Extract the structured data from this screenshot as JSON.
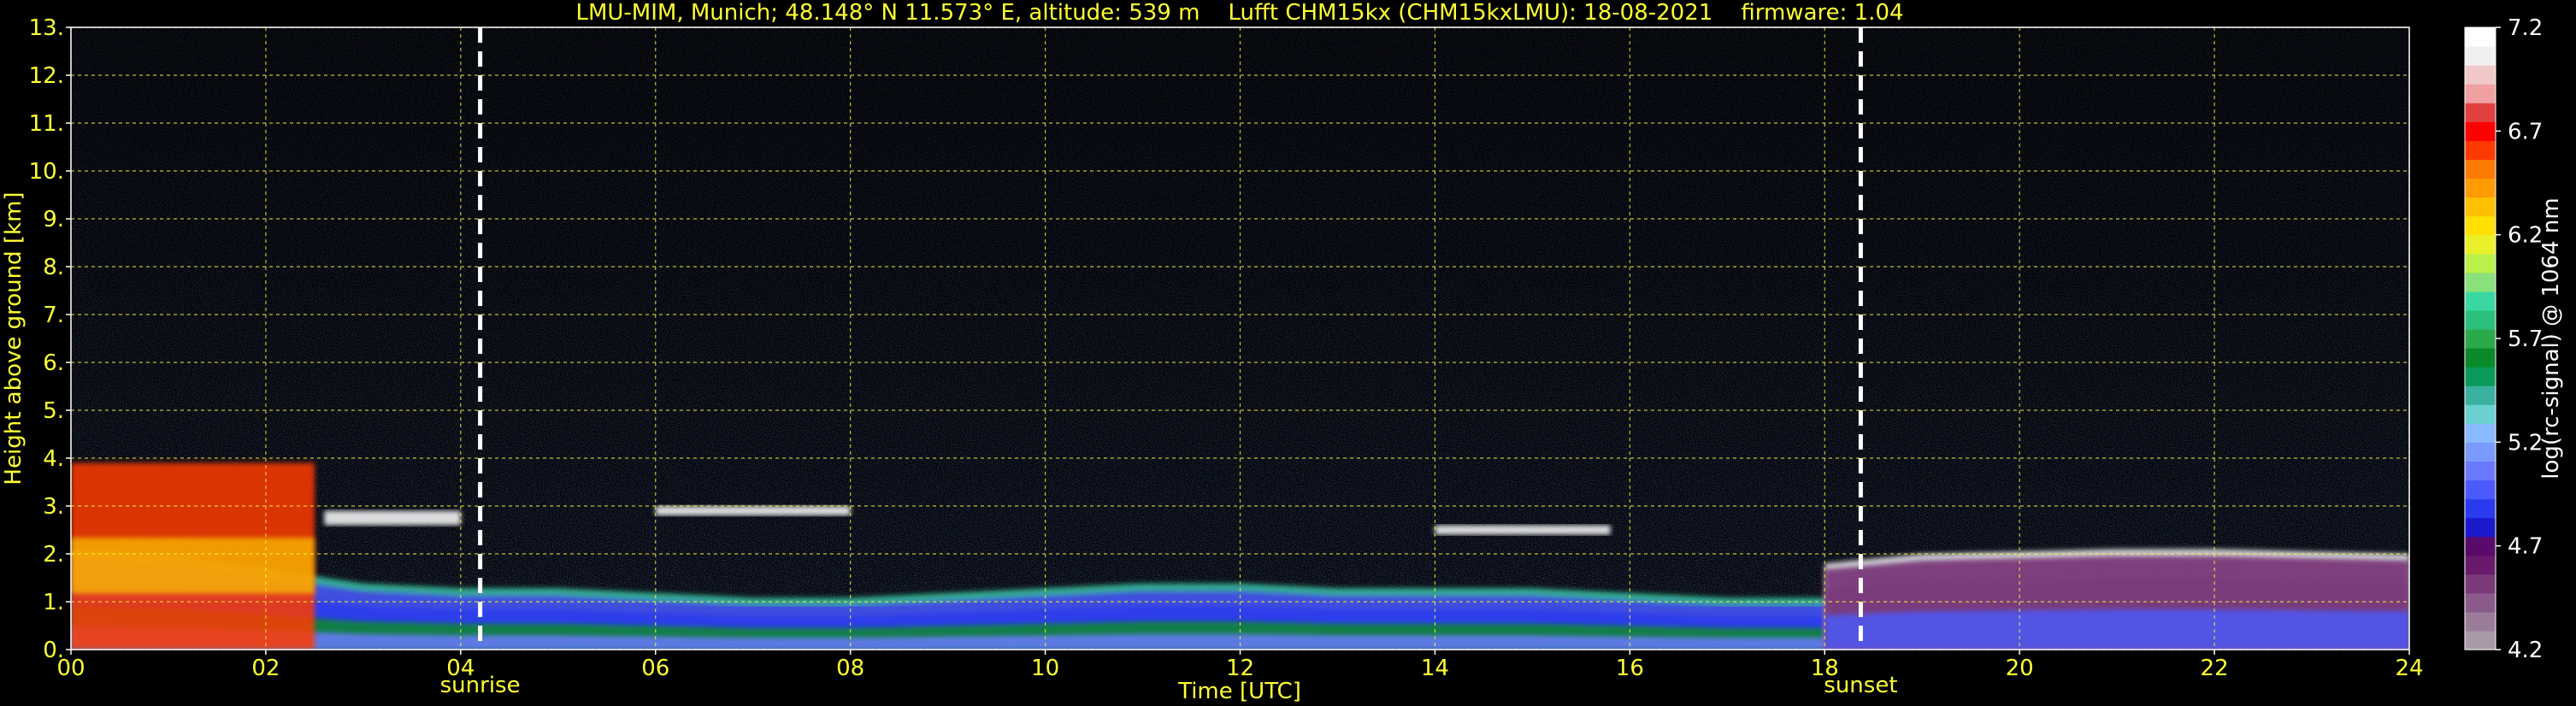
{
  "chart_data": {
    "type": "heatmap",
    "title": "LMU-MIM, Munich; 48.148° N 11.573° E, altitude: 539 m    Lufft CHM15kx (CHM15kxLMU): 18-08-2021    firmware: 1.04",
    "xlabel": "Time [UTC]",
    "ylabel": "Height above ground [km]",
    "xlim": [
      0,
      24
    ],
    "ylim": [
      0,
      13
    ],
    "x_ticks": [
      "00",
      "02",
      "04",
      "06",
      "08",
      "10",
      "12",
      "14",
      "16",
      "18",
      "20",
      "22",
      "24"
    ],
    "y_ticks": [
      "0.",
      "1.",
      "2.",
      "3.",
      "4.",
      "5.",
      "6.",
      "7.",
      "8.",
      "9.",
      "10.",
      "11.",
      "12.",
      "13."
    ],
    "grid": true,
    "colorbar": {
      "label": "log(rc-signal) @ 1064 nm",
      "range": [
        4.2,
        7.2
      ],
      "ticks": [
        "4.2",
        "4.7",
        "5.2",
        "5.7",
        "6.2",
        "6.7",
        "7.2"
      ],
      "colors": [
        "#a89aa8",
        "#9a7c9a",
        "#8a5a8a",
        "#7a3a7a",
        "#6a1a6a",
        "#5a0a6a",
        "#1a1acc",
        "#2a3aee",
        "#4a5aff",
        "#6a7aff",
        "#7a9aff",
        "#8abaff",
        "#6ad0d0",
        "#3ab0a0",
        "#0a9a5a",
        "#0a8a2a",
        "#2aaa4a",
        "#2ac07a",
        "#3ad8a0",
        "#8ae07a",
        "#baf04a",
        "#eaf02a",
        "#ffe000",
        "#ffc000",
        "#ff9a00",
        "#ff7a00",
        "#ff3a00",
        "#ff0000",
        "#e04040",
        "#f0a0a0",
        "#f0c8c8",
        "#f0f0f0",
        "#ffffff"
      ]
    },
    "annotations": [
      {
        "label": "sunrise",
        "x": 4.2
      },
      {
        "label": "sunset",
        "x": 18.37
      }
    ],
    "features": [
      {
        "kind": "boundary-layer",
        "x": [
          0,
          1,
          2,
          3,
          4,
          5,
          6,
          7,
          8,
          9,
          10,
          11,
          12,
          13,
          14,
          15,
          16,
          17,
          18,
          19,
          20,
          21,
          22,
          23,
          24
        ],
        "top_km": [
          2.0,
          1.9,
          1.6,
          1.3,
          1.2,
          1.2,
          1.1,
          1.0,
          1.0,
          1.1,
          1.2,
          1.3,
          1.3,
          1.2,
          1.2,
          1.2,
          1.1,
          1.0,
          1.0,
          1.2,
          1.3,
          1.3,
          1.3,
          1.3,
          1.3
        ]
      },
      {
        "kind": "residual-layer",
        "x": [
          18.0,
          19,
          20,
          21,
          22,
          23,
          24
        ],
        "top_km": [
          1.8,
          2.0,
          2.05,
          2.1,
          2.1,
          2.05,
          2.0
        ]
      },
      {
        "kind": "cloud",
        "x_start": 0.0,
        "x_end": 2.5,
        "height_km": [
          0.0,
          3.9
        ],
        "color": "#ff3a00"
      },
      {
        "kind": "cloud",
        "x_start": 6.0,
        "x_end": 8.0,
        "height_km": [
          2.8,
          3.0
        ],
        "color": "#ffffff"
      },
      {
        "kind": "cloud",
        "x_start": 14.0,
        "x_end": 15.8,
        "height_km": [
          2.4,
          2.6
        ],
        "color": "#ffffff"
      },
      {
        "kind": "cloud",
        "x_start": 2.6,
        "x_end": 4.0,
        "height_km": [
          2.6,
          2.9
        ],
        "color": "#ffffff"
      }
    ]
  }
}
